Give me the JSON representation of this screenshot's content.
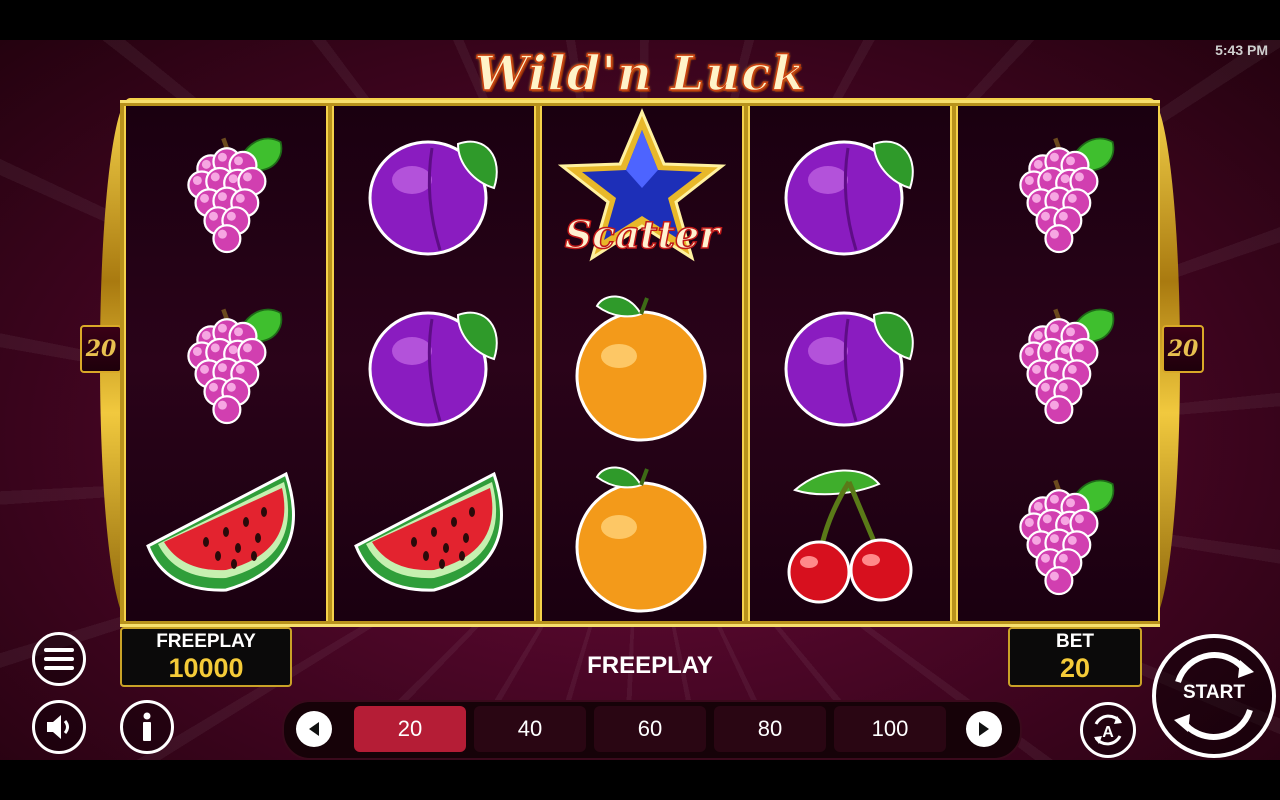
{
  "status_bar": {
    "time": "5:43 PM"
  },
  "game": {
    "title": "Wild'n Luck 20",
    "lines_left": "20",
    "lines_right": "20",
    "reels": [
      [
        "grapes",
        "grapes",
        "watermelon"
      ],
      [
        "plum",
        "plum",
        "watermelon"
      ],
      [
        "scatter-star",
        "orange",
        "orange"
      ],
      [
        "plum",
        "plum",
        "cherries"
      ],
      [
        "grapes",
        "grapes",
        "grapes"
      ]
    ],
    "scatter_text": "Scatter"
  },
  "hud": {
    "balance_label": "FREEPLAY",
    "balance_value": "10000",
    "mode_text": "FREEPLAY",
    "bet_label": "BET",
    "bet_value": "20",
    "start_label": "START",
    "bet_options": [
      "20",
      "40",
      "60",
      "80",
      "100"
    ],
    "selected_bet": "20"
  },
  "colors": {
    "accent_gold": "#f5cb38",
    "selected_bet": "#b51d36",
    "background": "#4a0626"
  },
  "icons": [
    "menu-icon",
    "speaker-icon",
    "info-icon",
    "chevron-left-icon",
    "chevron-right-icon",
    "autoplay-icon",
    "start-arrows-icon"
  ]
}
